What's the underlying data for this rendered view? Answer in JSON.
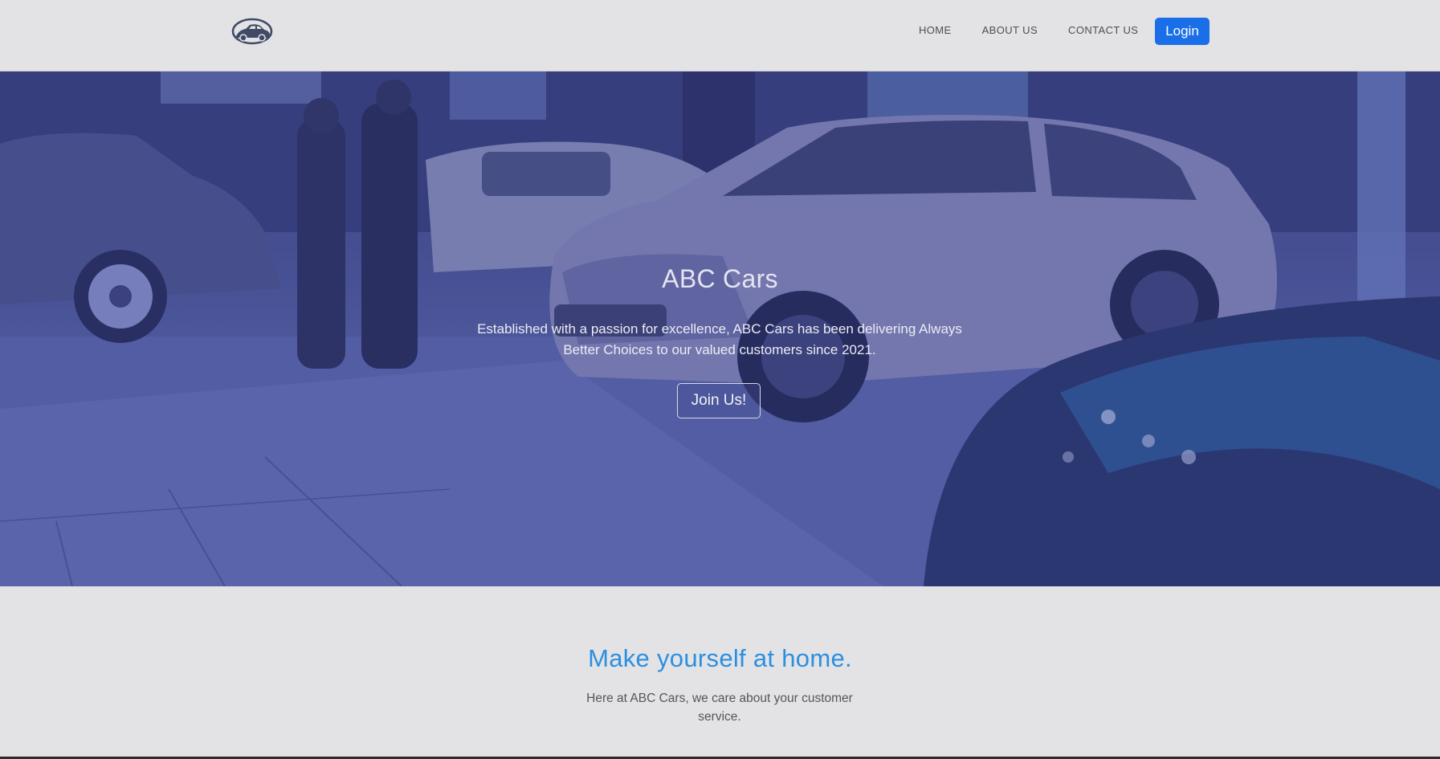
{
  "navbar": {
    "logo_icon": "car-logo-icon",
    "links": [
      {
        "label": "HOME"
      },
      {
        "label": "ABOUT US"
      },
      {
        "label": "CONTACT US"
      }
    ],
    "login_label": "Login",
    "accent_color": "#1a6fe8"
  },
  "hero": {
    "title": "ABC Cars",
    "text": "Established with a passion for excellence, ABC Cars has been delivering Always Better Choices to our valued customers since 2021.",
    "join_label": "Join Us!",
    "background_image": "car-showroom-photo"
  },
  "welcome": {
    "heading": "Make yourself at home.",
    "text": "Here at ABC Cars, we care about your customer service.",
    "heading_color": "#2b8fe0"
  }
}
